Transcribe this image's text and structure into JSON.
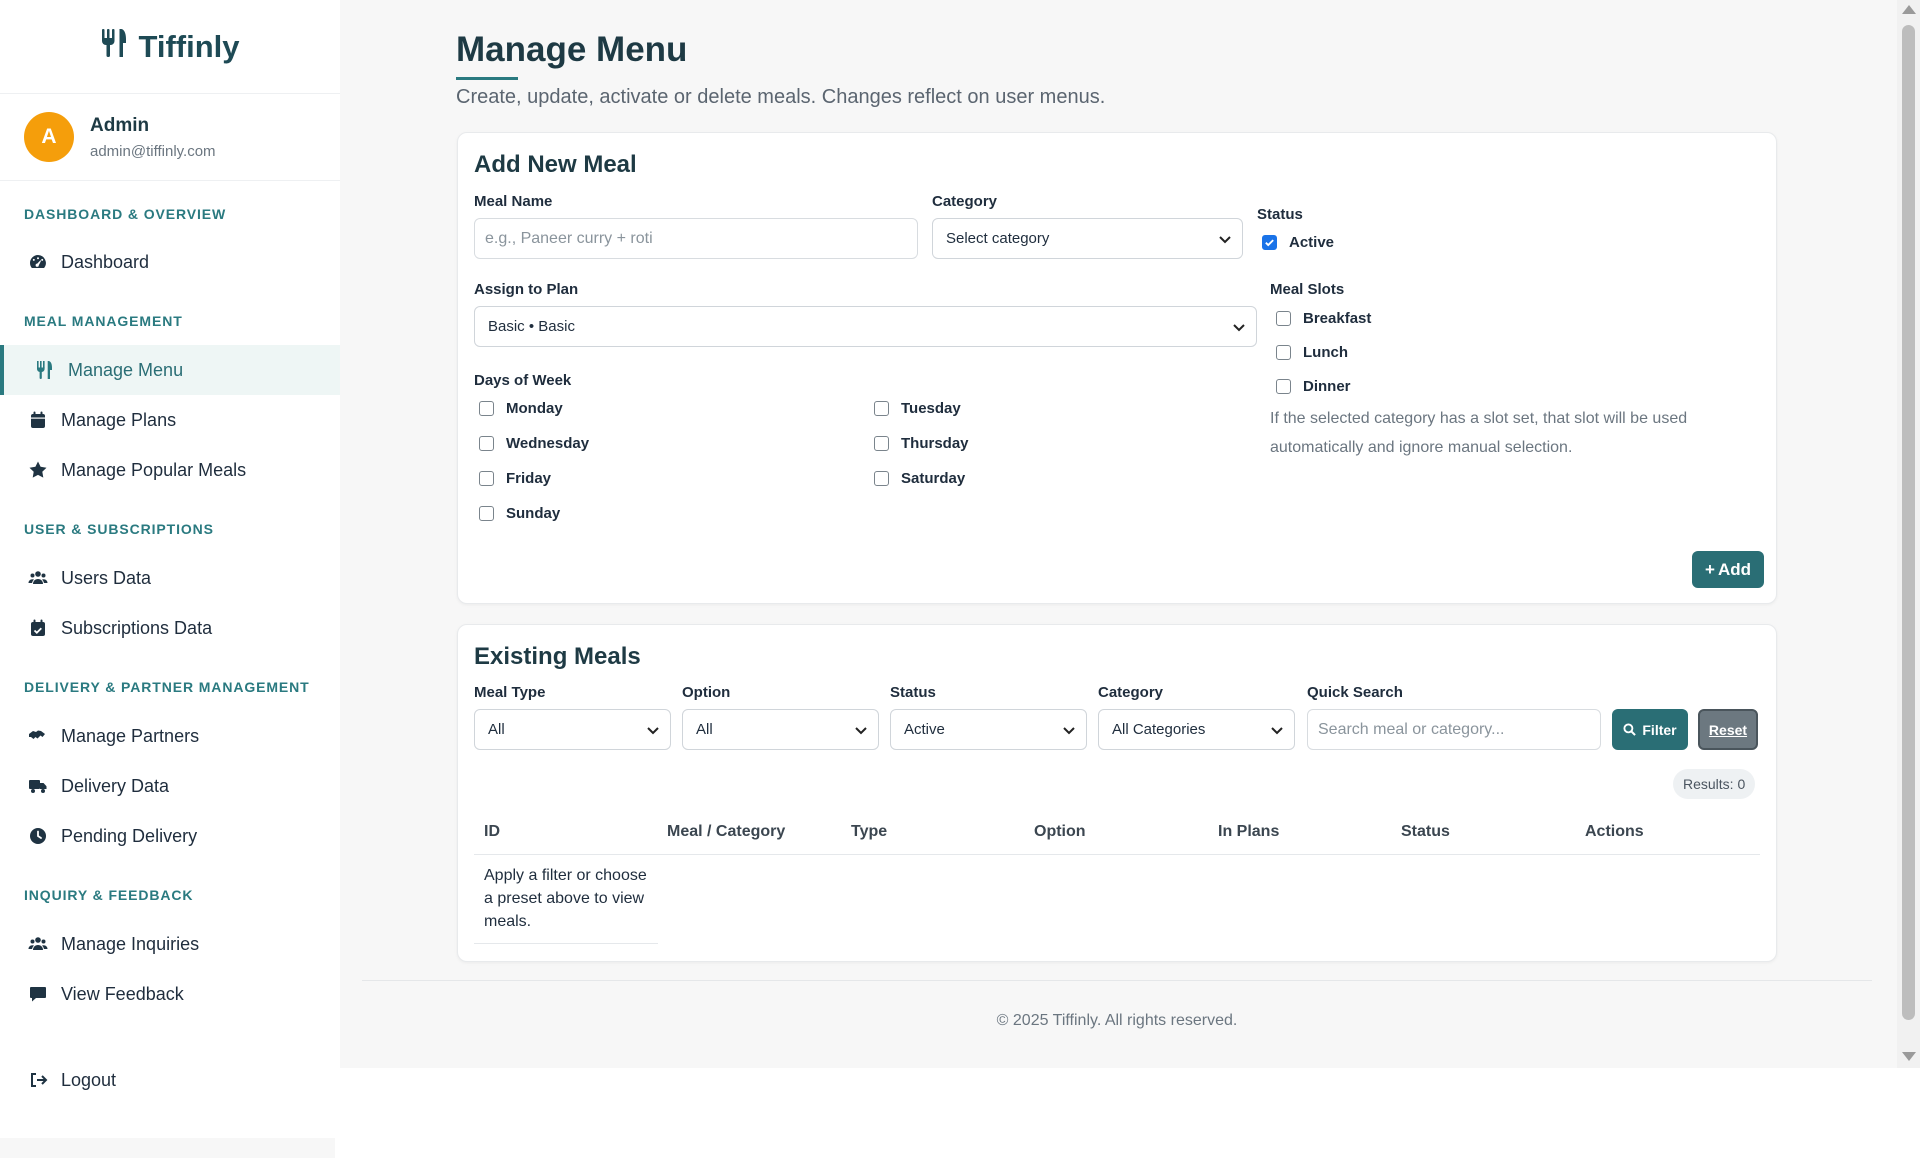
{
  "brand": {
    "name": "Tiffinly"
  },
  "profile": {
    "initial": "A",
    "name": "Admin",
    "email": "admin@tiffinly.com"
  },
  "sidebar": {
    "sections": [
      {
        "title": "Dashboard & Overview"
      },
      {
        "title": "Meal Management"
      },
      {
        "title": "User & Subscriptions"
      },
      {
        "title": "Delivery & Partner Management"
      },
      {
        "title": "Inquiry & Feedback"
      }
    ],
    "items": [
      {
        "label": "Dashboard"
      },
      {
        "label": "Manage Menu"
      },
      {
        "label": "Manage Plans"
      },
      {
        "label": "Manage Popular Meals"
      },
      {
        "label": "Users Data"
      },
      {
        "label": "Subscriptions Data"
      },
      {
        "label": "Manage Partners"
      },
      {
        "label": "Delivery Data"
      },
      {
        "label": "Pending Delivery"
      },
      {
        "label": "Manage Inquiries"
      },
      {
        "label": "View Feedback"
      }
    ],
    "logout_label": "Logout"
  },
  "page": {
    "title": "Manage Menu",
    "subtitle": "Create, update, activate or delete meals. Changes reflect on user menus."
  },
  "add_meal": {
    "title": "Add New Meal",
    "meal_name_label": "Meal Name",
    "meal_name_placeholder": "e.g., Paneer curry + roti",
    "category_label": "Category",
    "category_value": "Select category",
    "status_label": "Status",
    "active_label": "Active",
    "active_checked": true,
    "plan_label": "Assign to Plan",
    "plan_value": "Basic • Basic",
    "days_label": "Days of Week",
    "days": [
      "Monday",
      "Tuesday",
      "Wednesday",
      "Thursday",
      "Friday",
      "Saturday",
      "Sunday"
    ],
    "slots_label": "Meal Slots",
    "slots": [
      "Breakfast",
      "Lunch",
      "Dinner"
    ],
    "slot_note": "If the selected category has a slot set, that slot will be used automatically and ignore manual selection.",
    "add_button": "Add"
  },
  "existing": {
    "title": "Existing Meals",
    "filters": {
      "meal_type_label": "Meal Type",
      "meal_type_value": "All",
      "option_label": "Option",
      "option_value": "All",
      "status_label": "Status",
      "status_value": "Active",
      "category_label": "Category",
      "category_value": "All Categories",
      "search_label": "Quick Search",
      "search_placeholder": "Search meal or category...",
      "filter_button": "Filter",
      "reset_button": "Reset"
    },
    "results": "Results: 0",
    "columns": [
      "ID",
      "Meal / Category",
      "Type",
      "Option",
      "In Plans",
      "Status",
      "Actions"
    ],
    "empty_message": "Apply a filter or choose a preset above to view meals."
  },
  "footer": {
    "text": "© 2025 Tiffinly. All rights reserved."
  },
  "colors": {
    "accent": "#2a7a80",
    "avatar": "#f59e0b",
    "heading": "#1e3a44"
  }
}
